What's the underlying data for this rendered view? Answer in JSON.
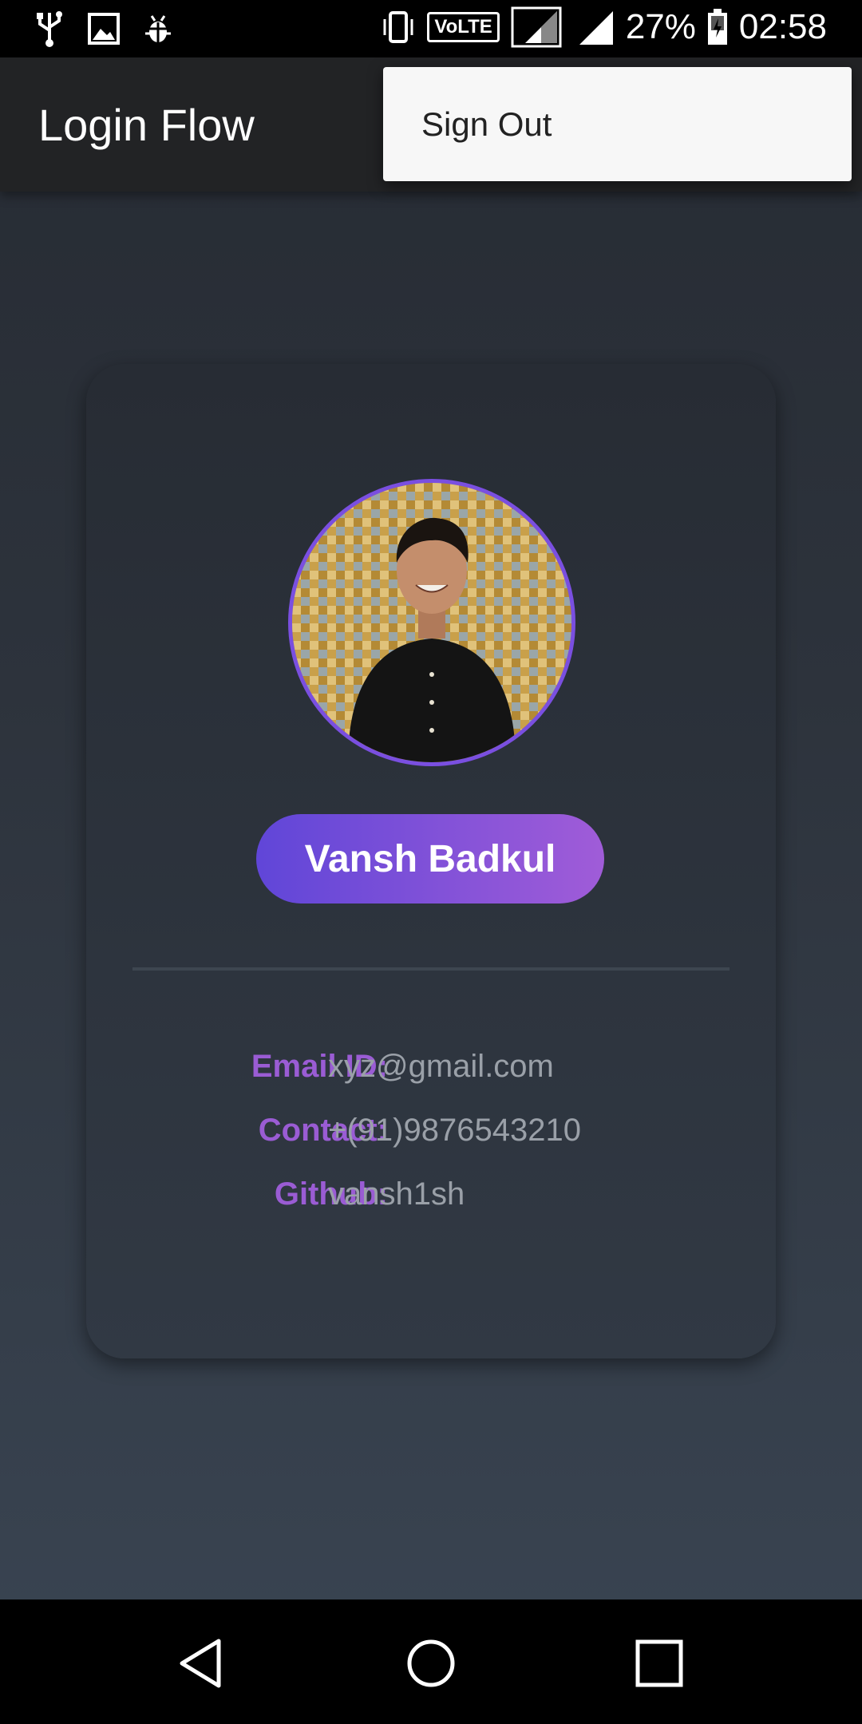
{
  "status_bar": {
    "battery": "27%",
    "time": "02:58",
    "network_badge": "VoLTE",
    "icons_left": [
      "usb-icon",
      "image-icon",
      "bug-icon"
    ],
    "icons_right": [
      "vibrate-icon",
      "volte-icon",
      "signal-sim1-icon",
      "signal-sim2-icon",
      "battery-charging-icon"
    ]
  },
  "app_bar": {
    "title": "Login Flow"
  },
  "overflow_menu": {
    "items": [
      {
        "label": "Sign Out"
      }
    ]
  },
  "profile": {
    "name": "Vansh Badkul",
    "fields": [
      {
        "label": "Email ID:",
        "value": "xyz@gmail.com"
      },
      {
        "label": "Contact:",
        "value": "+(91)9876543210"
      },
      {
        "label": "Github:",
        "value": "vansh1sh"
      }
    ]
  },
  "nav_bar": {
    "buttons": [
      "back-icon",
      "home-icon",
      "recents-icon"
    ]
  },
  "colors": {
    "accent": "#7a4fe0",
    "label": "#9a5cd4",
    "pill_start": "#6046d8",
    "pill_end": "#a05cd8"
  }
}
